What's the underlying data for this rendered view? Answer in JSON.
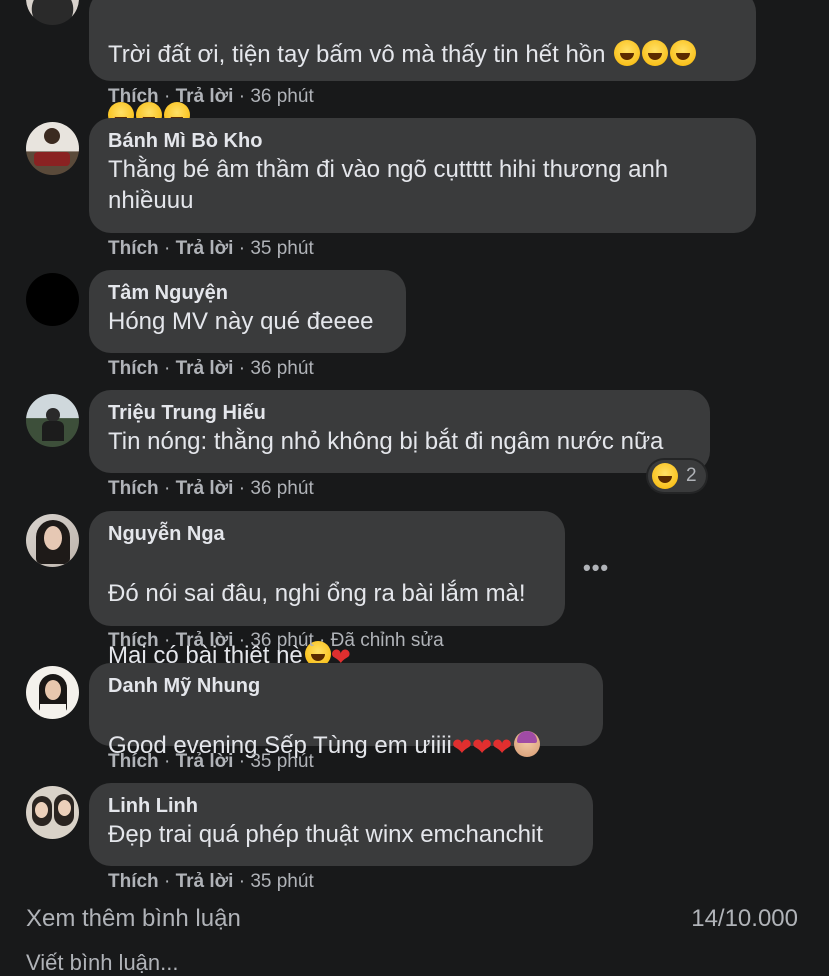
{
  "comments": [
    {
      "author": "",
      "text": "Trời đất ơi, tiện tay bấm vô mà thấy tin hết hồn",
      "like": "Thích",
      "reply": "Trả lời",
      "time": "36 phút"
    },
    {
      "author": "Bánh Mì Bò Kho",
      "text": "Thằng bé âm thầm đi vào ngõ cụttttt hihi thương anh\nnhiềuuu",
      "like": "Thích",
      "reply": "Trả lời",
      "time": "35 phút"
    },
    {
      "author": "Tâm Nguyện",
      "text": "Hóng MV này qué đeeee",
      "like": "Thích",
      "reply": "Trả lời",
      "time": "36 phút"
    },
    {
      "author": "Triệu Trung Hiếu",
      "text": "Tin nóng: thằng nhỏ không bị bắt đi ngâm nước nữa",
      "like": "Thích",
      "reply": "Trả lời",
      "time": "36 phút",
      "reaction_count": "2"
    },
    {
      "author": "Nguyễn Nga",
      "text_line1": "Đó nói sai đâu, nghi ổng ra bài lắm mà!",
      "text_line2": "Mai có bài thiệt nè",
      "like": "Thích",
      "reply": "Trả lời",
      "time": "36 phút",
      "edited": "Đã chỉnh sửa",
      "more": "•••"
    },
    {
      "author": "Danh Mỹ Nhung",
      "text": "Good evening Sếp Tùng em ưiiii",
      "like": "Thích",
      "reply": "Trả lời",
      "time": "35 phút"
    },
    {
      "author": "Linh Linh",
      "text": "Đẹp trai quá phép thuật winx emchanchit",
      "like": "Thích",
      "reply": "Trả lời",
      "time": "35 phút"
    }
  ],
  "footer": {
    "view_more": "Xem thêm bình luận",
    "count": "14/10.000",
    "write_comment_partial": "Viết bình luận..."
  },
  "separator": " · ",
  "colors": {
    "background": "#18191a",
    "bubble": "#3a3b3c",
    "text": "#e4e6eb",
    "secondary": "#b0b3b8"
  }
}
